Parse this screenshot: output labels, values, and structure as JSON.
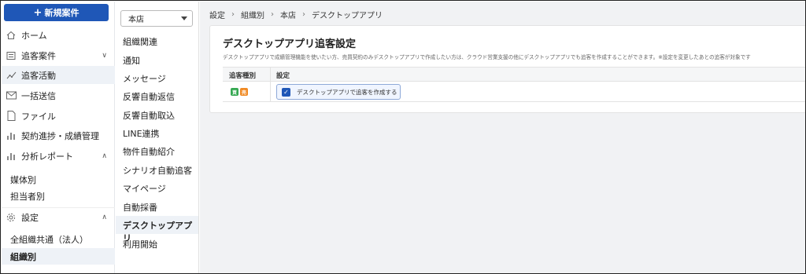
{
  "sidebar": {
    "new_button": "新規案件",
    "items": [
      {
        "label": "ホーム",
        "icon": "home-icon"
      },
      {
        "label": "追客案件",
        "icon": "list-icon"
      },
      {
        "label": "追客活動",
        "icon": "activity-icon"
      },
      {
        "label": "一括送信",
        "icon": "mail-icon"
      },
      {
        "label": "ファイル",
        "icon": "file-icon"
      },
      {
        "label": "契約進捗・成績管理",
        "icon": "bar-chart-icon"
      },
      {
        "label": "分析レポート",
        "icon": "bar-chart-icon"
      }
    ],
    "report_subitems": [
      "媒体別",
      "担当者別"
    ],
    "settings_label": "設定",
    "settings_subitems": [
      "全組織共通（法人）",
      "組織別"
    ]
  },
  "settings_nav": {
    "store_select": "本店",
    "items": [
      "組織関連",
      "通知",
      "メッセージ",
      "反響自動返信",
      "反響自動取込",
      "LINE連携",
      "物件自動紹介",
      "シナリオ自動追客",
      "マイページ",
      "自動採番",
      "デスクトップアプリ",
      "利用開始"
    ],
    "selected": "デスクトップアプリ"
  },
  "breadcrumb": [
    "設定",
    "組織別",
    "本店",
    "デスクトップアプリ"
  ],
  "card": {
    "title": "デスクトップアプリ追客設定",
    "description": "デスクトップアプリで成績管理機能を使いたい方、売買契約のみデスクトップアプリで作成したい方は、クラウド営業支援の他にデスクトップアプリでも追客を作成することができます。※設定を変更したあとの追客が対象です",
    "columns": [
      "追客種別",
      "設定"
    ],
    "row": {
      "tags": [
        {
          "text": "買",
          "color": "#35a852"
        },
        {
          "text": "売",
          "color": "#f08a24"
        }
      ],
      "checkbox_label": "デスクトップアプリで追客を作成する",
      "checked": true
    }
  },
  "colors": {
    "accent": "#1f57b7"
  }
}
